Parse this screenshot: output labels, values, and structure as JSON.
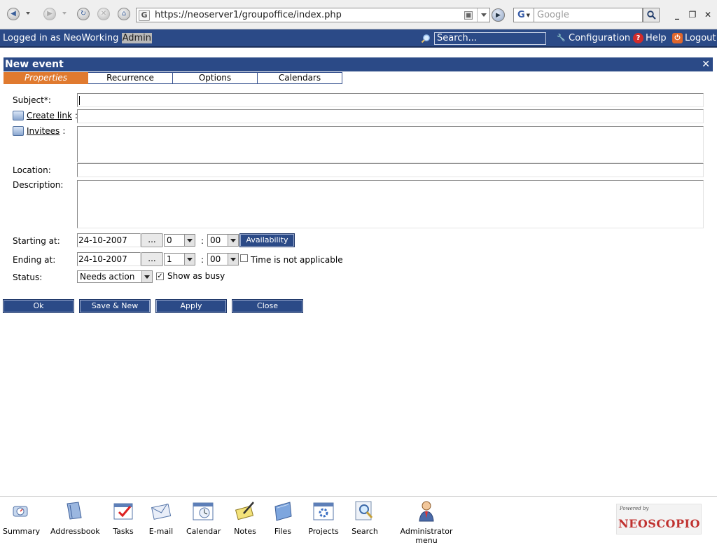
{
  "browser": {
    "url": "https://neoserver1/groupoffice/index.php",
    "search_placeholder": "Google",
    "favicon_letter": "G",
    "search_engine_letter": "G"
  },
  "header": {
    "logged_in_prefix": "Logged in as NeoWorking",
    "user": "Admin",
    "search_value": "Search...",
    "configuration": "Configuration",
    "help": "Help",
    "logout": "Logout"
  },
  "dialog": {
    "title": "New event",
    "close_glyph": "✕",
    "tabs": [
      "Properties",
      "Recurrence",
      "Options",
      "Calendars"
    ],
    "active_tab": "Properties"
  },
  "form": {
    "subject_label": "Subject*:",
    "create_link_label": "Create link",
    "invitees_label": "Invitees",
    "location_label": "Location:",
    "description_label": "Description:",
    "starting_label": "Starting at:",
    "ending_label": "Ending at:",
    "status_label": "Status:",
    "start_date": "24-10-2007",
    "start_hour": "0",
    "start_minute": "00",
    "end_date": "24-10-2007",
    "end_hour": "1",
    "end_minute": "00",
    "dots": "...",
    "colon": ":",
    "availability": "Availability",
    "time_na_label": "Time is not applicable",
    "time_na_checked": false,
    "status_value": "Needs action",
    "show_busy_label": "Show as busy",
    "show_busy_checked": true
  },
  "actions": {
    "ok": "Ok",
    "save_new": "Save & New",
    "apply": "Apply",
    "close": "Close"
  },
  "modules": [
    {
      "label": "Summary",
      "icon": "summary-icon"
    },
    {
      "label": "Addressbook",
      "icon": "addressbook-icon"
    },
    {
      "label": "Tasks",
      "icon": "tasks-icon"
    },
    {
      "label": "E-mail",
      "icon": "email-icon"
    },
    {
      "label": "Calendar",
      "icon": "calendar-icon"
    },
    {
      "label": "Notes",
      "icon": "notes-icon"
    },
    {
      "label": "Files",
      "icon": "files-icon"
    },
    {
      "label": "Projects",
      "icon": "projects-icon"
    },
    {
      "label": "Search",
      "icon": "search-module-icon"
    },
    {
      "label": "Administrator menu",
      "icon": "administrator-icon"
    }
  ],
  "branding": {
    "powered_by": "Powered by",
    "name": "NEOSCOPIO"
  },
  "colors": {
    "header_blue": "#2b4a87",
    "active_tab": "#e07a2f",
    "brand_red": "#c0312f"
  }
}
